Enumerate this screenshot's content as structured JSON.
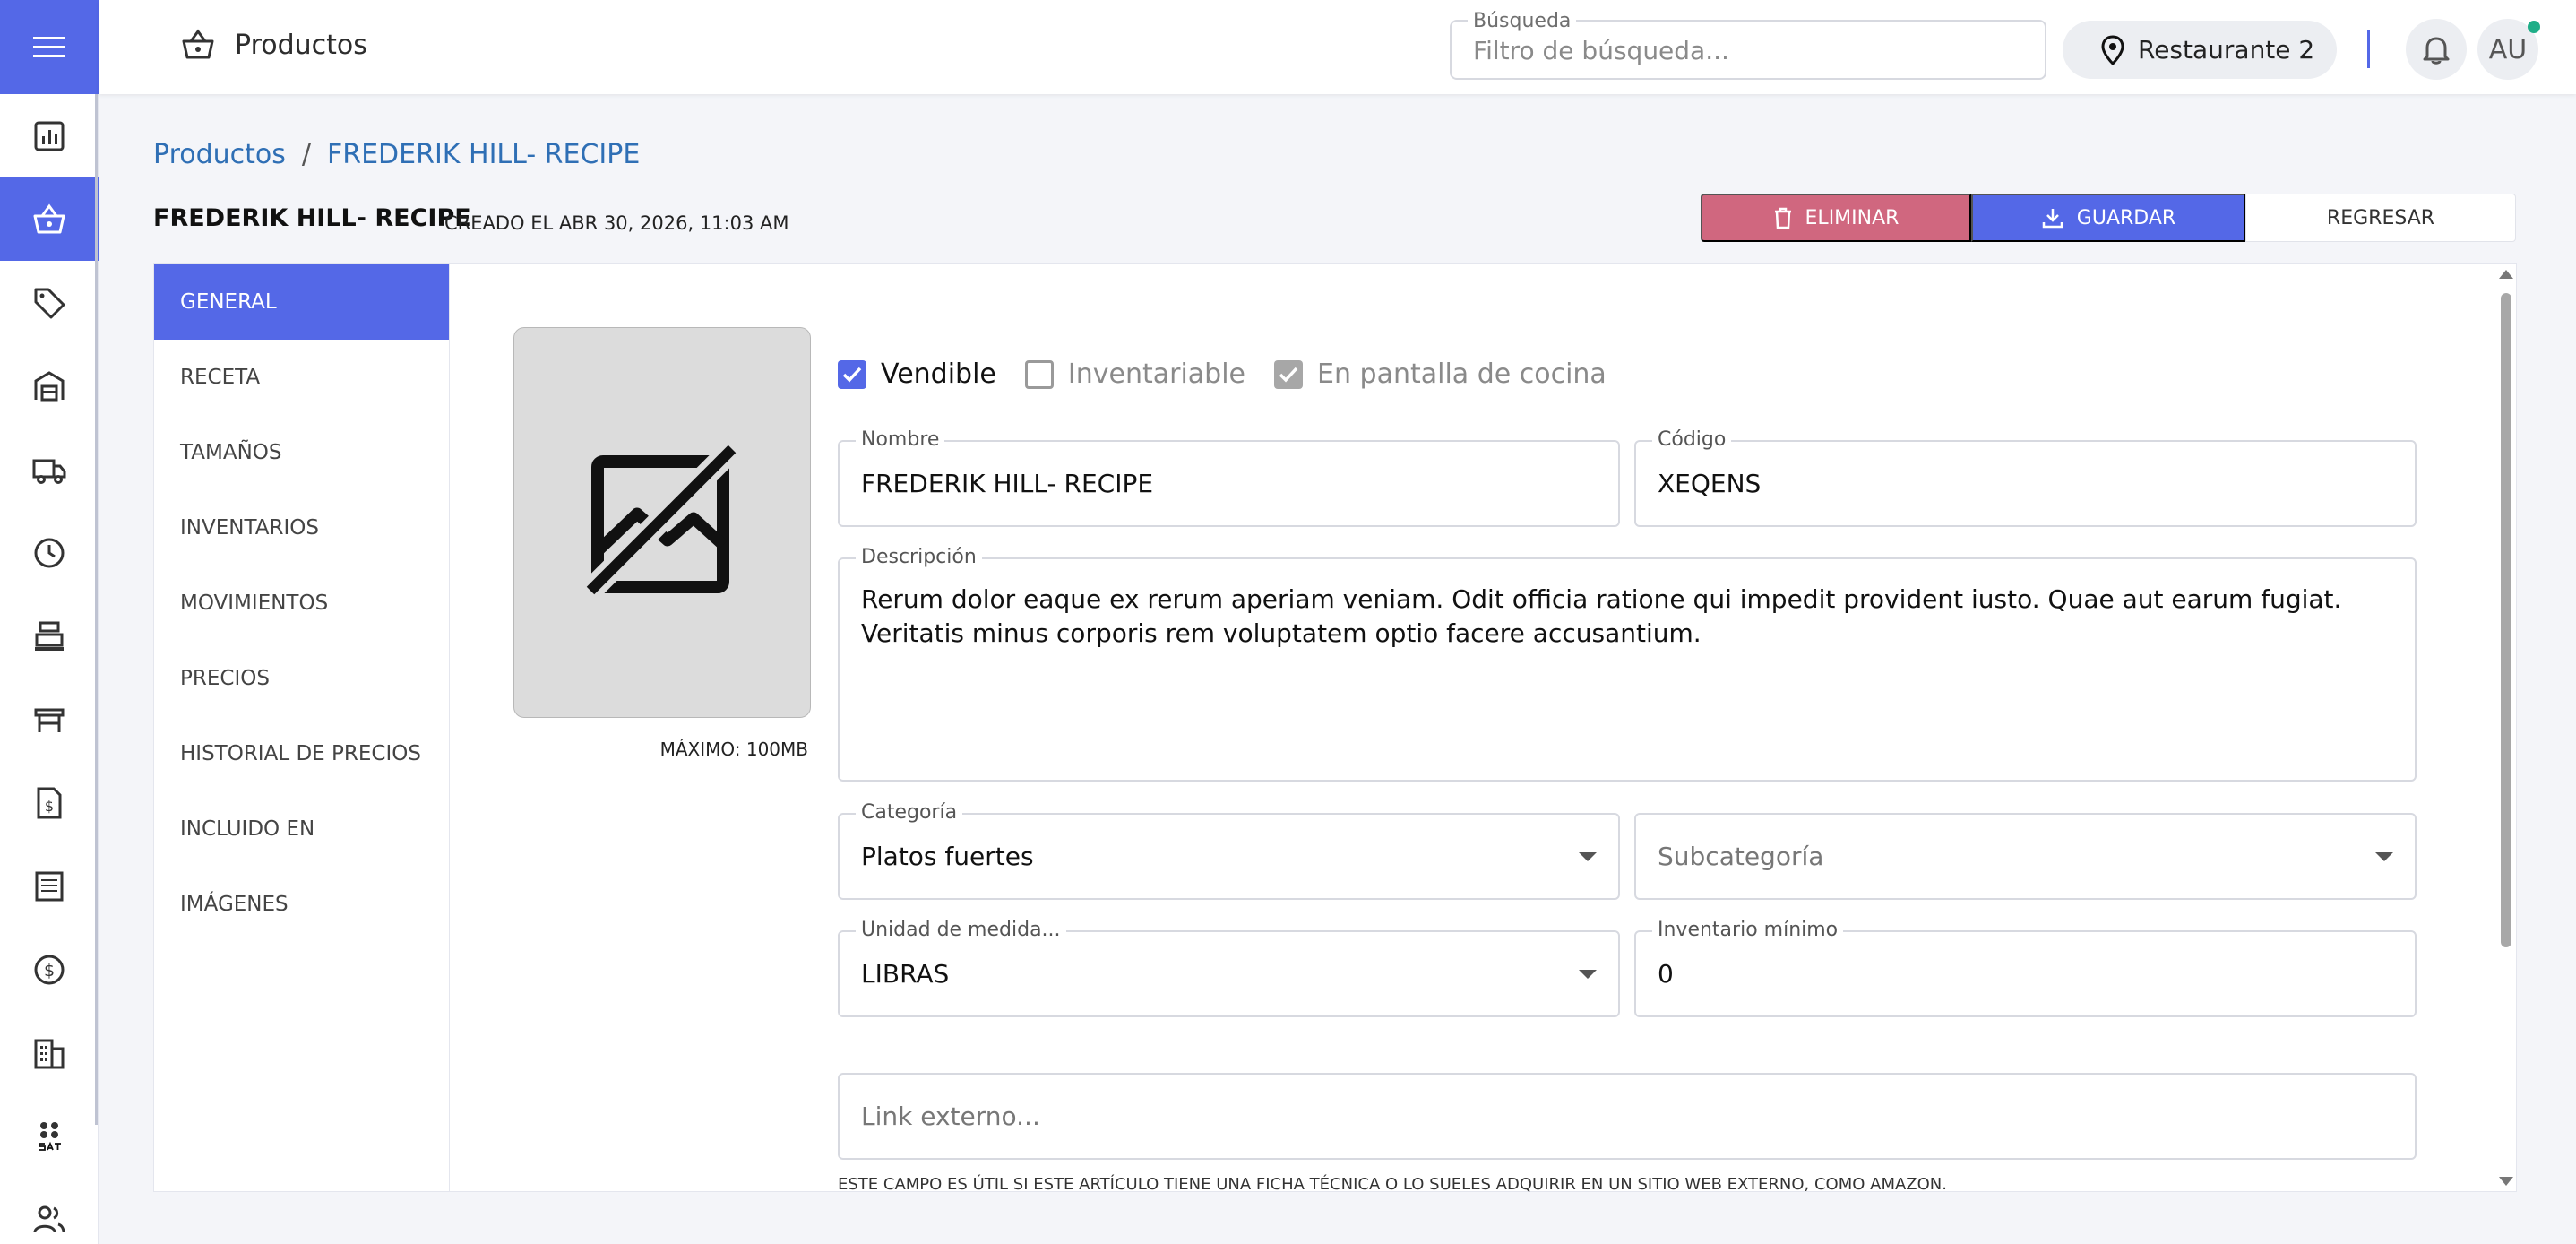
{
  "header": {
    "title": "Productos",
    "search_legend": "Búsqueda",
    "search_placeholder": "Filtro de búsqueda...",
    "location": "Restaurante 2",
    "avatar_initials": "AU"
  },
  "breadcrumb": {
    "root": "Productos",
    "separator": "/",
    "current": "FREDERIK HILL- RECIPE"
  },
  "page": {
    "title": "FREDERIK HILL- RECIPE",
    "created": "CREADO EL ABR 30, 2026, 11:03 AM"
  },
  "actions": {
    "delete_label": "ELIMINAR",
    "save_label": "GUARDAR",
    "back_label": "REGRESAR"
  },
  "tabs": [
    {
      "label": "GENERAL",
      "active": true
    },
    {
      "label": "RECETA"
    },
    {
      "label": "TAMAÑOS"
    },
    {
      "label": "INVENTARIOS"
    },
    {
      "label": "MOVIMIENTOS"
    },
    {
      "label": "PRECIOS"
    },
    {
      "label": "HISTORIAL DE PRECIOS"
    },
    {
      "label": "INCLUIDO EN"
    },
    {
      "label": "IMÁGENES"
    }
  ],
  "image": {
    "max_label": "MÁXIMO: 100MB"
  },
  "checkboxes": {
    "vendible": {
      "label": "Vendible",
      "checked": true
    },
    "inventariable": {
      "label": "Inventariable",
      "checked": false
    },
    "pantalla": {
      "label": "En pantalla de cocina",
      "checked": true
    }
  },
  "form": {
    "nombre": {
      "label": "Nombre",
      "value": "FREDERIK HILL- RECIPE"
    },
    "codigo": {
      "label": "Código",
      "value": "XEQENS"
    },
    "descripcion": {
      "label": "Descripción",
      "value": "Rerum dolor eaque ex rerum aperiam veniam. Odit officia ratione qui impedit provident iusto. Quae aut earum fugiat. Veritatis minus corporis rem voluptatem optio facere accusantium."
    },
    "categoria": {
      "label": "Categoría",
      "value": "Platos fuertes"
    },
    "subcategoria": {
      "placeholder": "Subcategoría"
    },
    "unidad": {
      "label": "Unidad de medida...",
      "value": "LIBRAS"
    },
    "inventario_minimo": {
      "label": "Inventario mínimo",
      "value": "0"
    },
    "link_externo": {
      "placeholder": "Link externo..."
    },
    "link_hint": "ESTE CAMPO ES ÚTIL SI ESTE ARTÍCULO TIENE UNA FICHA TÉCNICA O LO SUELES ADQUIRIR EN UN SITIO WEB EXTERNO, COMO AMAZON."
  },
  "colors": {
    "primary": "#5468e7",
    "danger": "#d0677f",
    "link": "#2f6fb5"
  },
  "sidebar_icons": [
    "chart-icon",
    "basket-icon",
    "tag-icon",
    "warehouse-icon",
    "truck-icon",
    "clock-icon",
    "cash-register-icon",
    "table-icon",
    "invoice-icon",
    "receipt-icon",
    "dollar-icon",
    "building-icon",
    "sat-icon",
    "users-icon"
  ]
}
